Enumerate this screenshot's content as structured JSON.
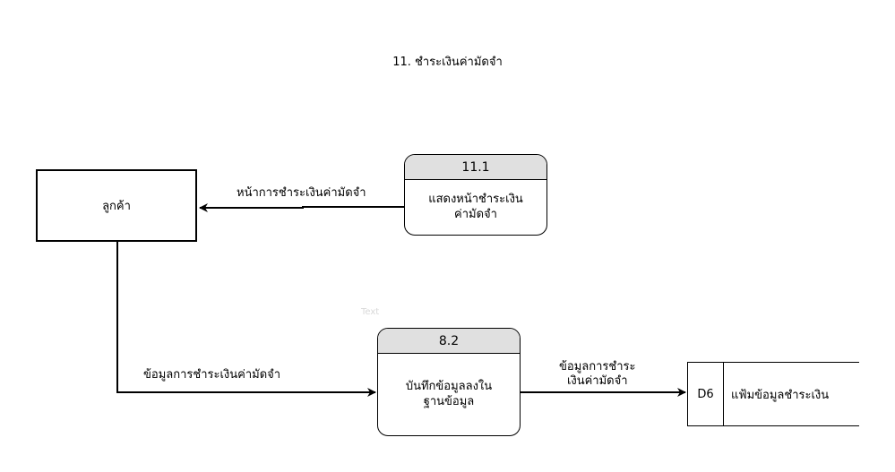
{
  "title": "11. ชำระเงินค่ามัดจำ",
  "entity": {
    "label": "ลูกค้า"
  },
  "processes": [
    {
      "id": "11.1",
      "name": "แสดงหน้าชำระเงิน\nค่ามัดจำ"
    },
    {
      "id": "8.2",
      "name": "บันทึกข้อมูลลงใน\nฐานข้อมูล"
    }
  ],
  "datastore": {
    "id": "D6",
    "name": "แฟ้มข้อมูลชำระเงิน"
  },
  "flows": [
    {
      "label": "หน้าการชำระเงินค่ามัดจำ"
    },
    {
      "label": "ข้อมูลการชำระเงินค่ามัดจำ"
    },
    {
      "label": "ข้อมูลการชำระ\nเงินค่ามัดจำ"
    }
  ],
  "ghost_text": "Text"
}
